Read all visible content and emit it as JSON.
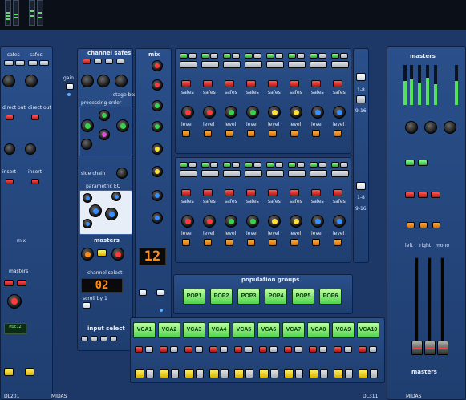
{
  "left_strip": {
    "safes": "safes",
    "gain_label": "gain",
    "direct_out_left": "direct out",
    "direct_out_right": "direct out",
    "insert_left": "insert",
    "insert_right": "insert",
    "mix": "mix",
    "masters": "masters",
    "bottom_id": "DL201"
  },
  "channel_safes": {
    "title": "channel safes",
    "stage_box": "stage box",
    "gain": "gain",
    "processing_order": "processing order",
    "side_chain": "side chain",
    "parametric_eq": "parametric EQ",
    "masters": "masters",
    "mix_label": "mix",
    "mix_display": "12",
    "channel_select": "channel select",
    "channel_display": "02",
    "scroll_by_1": "scroll by 1",
    "input_select": "input select"
  },
  "population_groups": {
    "title": "population groups",
    "buttons": [
      "POP1",
      "POP2",
      "POP3",
      "POP4",
      "POP5",
      "POP6"
    ]
  },
  "vca_row": {
    "buttons": [
      "VCA1",
      "VCA2",
      "VCA3",
      "VCA4",
      "VCA5",
      "VCA6",
      "VCA7",
      "VCA8",
      "VCA9",
      "VCA10"
    ]
  },
  "strips": {
    "safes_label": "safes",
    "level_label": "level",
    "bank_labels": [
      "1-8",
      "9-16"
    ]
  },
  "right_section": {
    "masters_top": "masters",
    "masters_bottom": "masters",
    "left": "left",
    "right": "right",
    "mono": "mono",
    "bottom_ids": [
      "MIDAS",
      "DL311",
      "MIDAS"
    ]
  },
  "colors": {
    "panel_blue": "#2a4f8a",
    "vca_green": "#4fd24f",
    "display_orange": "#ff8c1a"
  }
}
